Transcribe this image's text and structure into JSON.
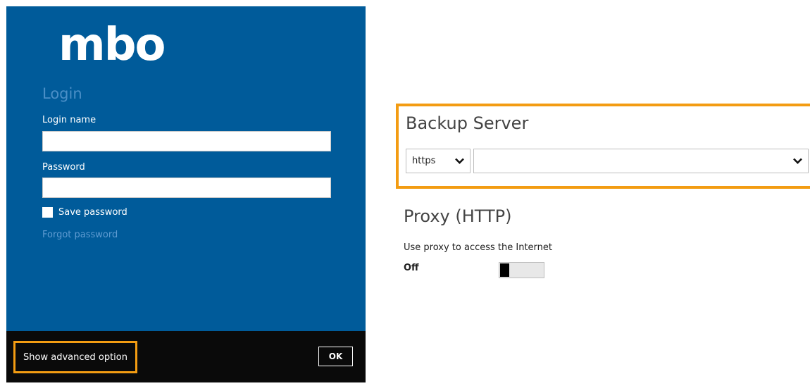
{
  "login": {
    "logo_text": "mbo",
    "title": "Login",
    "login_name_label": "Login name",
    "login_name_value": "",
    "password_label": "Password",
    "password_value": "",
    "save_password_label": "Save password",
    "save_password_checked": false,
    "forgot_password_link": "Forgot password"
  },
  "footer": {
    "advanced_option_label": "Show advanced option",
    "ok_label": "OK"
  },
  "backup_server": {
    "title": "Backup Server",
    "protocol": "https",
    "host_value": ""
  },
  "proxy": {
    "title": "Proxy (HTTP)",
    "description": "Use proxy to access the Internet",
    "state_label": "Off",
    "enabled": false
  },
  "colors": {
    "panel_blue": "#005b9a",
    "highlight_orange": "#f39c12",
    "footer_black": "#0a0a0a"
  }
}
